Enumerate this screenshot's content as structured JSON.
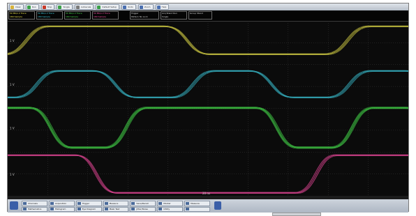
{
  "toolbar": {
    "buttons": [
      {
        "label": "Clear",
        "color": "#d7b33a"
      },
      {
        "label": "Run",
        "color": "#3aa048"
      },
      {
        "label": "Stop",
        "color": "#c93a2a"
      },
      {
        "label": "Single",
        "color": "#3aa048"
      },
      {
        "label": "Autoscale",
        "color": "#7a7a7a"
      },
      {
        "label": "Default Setup",
        "color": "#3aa048"
      },
      {
        "label": "Undo",
        "color": "#4a6fb0"
      },
      {
        "label": "Zoom",
        "color": "#4a6fb0"
      },
      {
        "label": "Help",
        "color": "#4a6fb0"
      }
    ]
  },
  "info": {
    "channels": [
      {
        "line1": "50 Mb/s   2 Trace",
        "line2": "180        Sample",
        "color": "#e8e24a"
      },
      {
        "line1": "50 Mb/s   2 Trace",
        "line2": "180        Sample",
        "color": "#3ecde0"
      },
      {
        "line1": "50 Mb/s   2 Trace",
        "line2": "180        Sample",
        "color": "#46d84a"
      },
      {
        "line1": "50 Mb/s   2 Trace",
        "line2": "180        Sample",
        "color": "#ff4fa8"
      }
    ],
    "trigger": {
      "line1": "Trigger",
      "line2": "Pattern No Lock"
    },
    "acquisition": {
      "line1": "Acq Stand   Run",
      "line2": "Single"
    },
    "group": {
      "line1": "Group Stand",
      "line2": ""
    }
  },
  "display": {
    "x_readout": "20 ns",
    "scale_labels": [
      "1 V",
      "1 V",
      "1 V",
      "1 V"
    ],
    "grid_color": "#3a3a3a",
    "traces": [
      {
        "name": "yellow",
        "color": "#e8e24a",
        "pattern": "0110",
        "thickness": 3
      },
      {
        "name": "cyan",
        "color": "#3ecde0",
        "pattern": "0101",
        "thickness": 3
      },
      {
        "name": "green",
        "color": "#46d84a",
        "pattern": "10110",
        "thickness": 4
      },
      {
        "name": "magenta",
        "color": "#ff4fa8",
        "pattern": "11000",
        "thickness": 3
      }
    ]
  },
  "bottom_menu": {
    "items": [
      "Channels",
      "Acquisition",
      "Trigger",
      "Measure",
      "Save/Recall",
      "Marker",
      "Measure",
      "Mathematics",
      "Histogram",
      "Eye Diagram",
      "Mask Test",
      "Jitter/Noise",
      "Utility",
      ""
    ]
  }
}
